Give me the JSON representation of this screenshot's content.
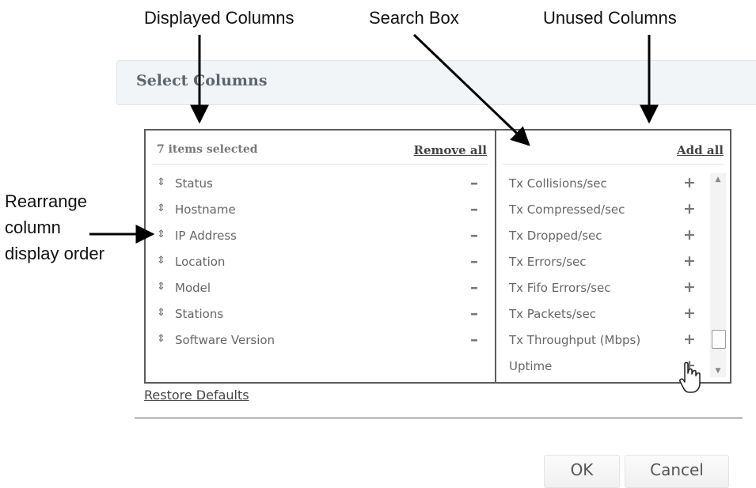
{
  "callouts": {
    "displayed": "Displayed Columns",
    "search": "Search Box",
    "unused": "Unused Columns",
    "rearrange_1": "Rearrange",
    "rearrange_2": "column",
    "rearrange_3": "display order"
  },
  "dialog": {
    "title": "Select Columns",
    "restore_label": "Restore Defaults",
    "ok_label": "OK",
    "cancel_label": "Cancel"
  },
  "displayed": {
    "count_label": "7 items selected",
    "remove_all_label": "Remove all",
    "grip_glyph": "⇕",
    "remove_glyph": "–",
    "items": [
      "Status",
      "Hostname",
      "IP Address",
      "Location",
      "Model",
      "Stations",
      "Software Version"
    ]
  },
  "unused": {
    "search_value": "",
    "add_all_label": "Add all",
    "add_glyph": "+",
    "items": [
      "Tx Collisions/sec",
      "Tx Compressed/sec",
      "Tx Dropped/sec",
      "Tx Errors/sec",
      "Tx Fifo Errors/sec",
      "Tx Packets/sec",
      "Tx Throughput (Mbps)",
      "Uptime"
    ]
  },
  "scrollbar": {
    "up_glyph": "▲",
    "down_glyph": "▼",
    "position": 0.9
  },
  "icons": {
    "row_handle": "drag-handle-icon",
    "cursor": "hand-pointer-icon"
  }
}
